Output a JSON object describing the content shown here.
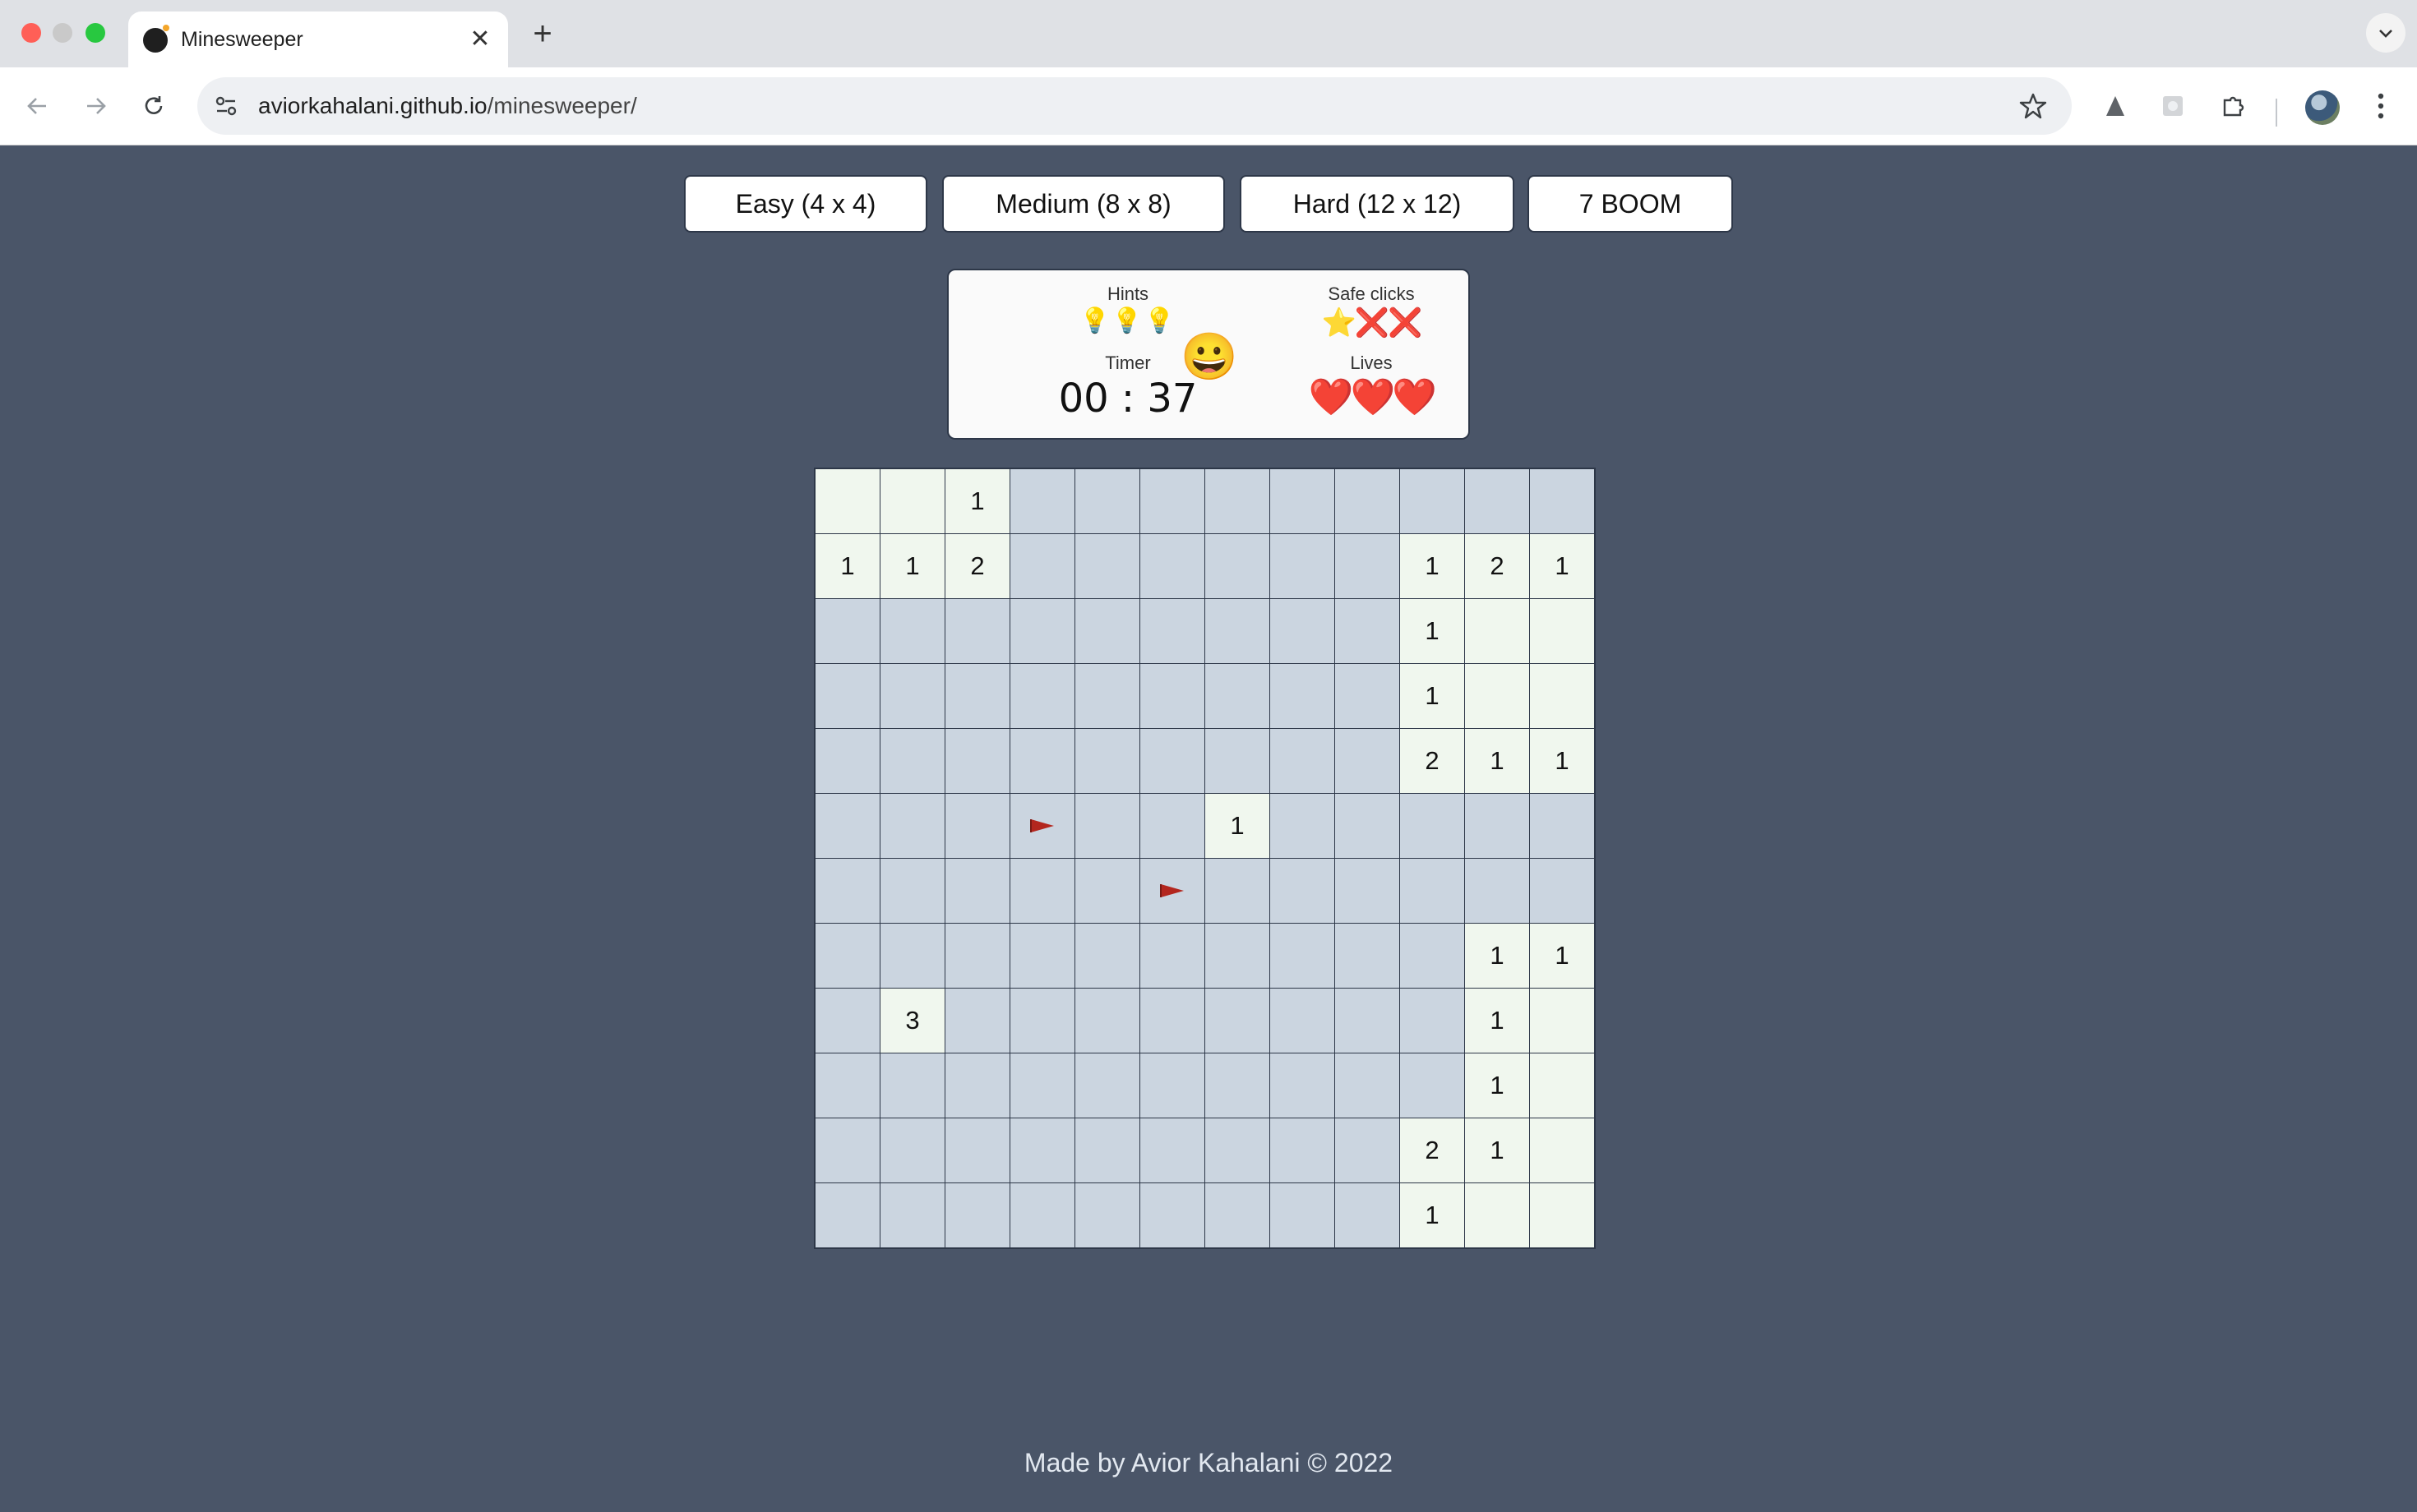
{
  "browser": {
    "tab_title": "Minesweeper",
    "tab_close": "✕",
    "new_tab": "+",
    "url_host": "aviorkahalani.github.io",
    "url_path": "/minesweeper/"
  },
  "levels": [
    {
      "label": "Easy (4 x 4)"
    },
    {
      "label": "Medium (8 x 8)"
    },
    {
      "label": "Hard (12 x 12)"
    },
    {
      "label": "7 BOOM"
    }
  ],
  "stats": {
    "hints_label": "Hints",
    "hints_value": "💡💡💡",
    "timer_label": "Timer",
    "timer_value": "00 : 37",
    "smiley": "😀",
    "safe_clicks_label": "Safe clicks",
    "safe_clicks_value": "⭐❌❌",
    "lives_label": "Lives",
    "lives_value": "❤️❤️❤️"
  },
  "board": {
    "rows": [
      [
        "R",
        "R",
        "1",
        "",
        "",
        "",
        "",
        "",
        "",
        "",
        "",
        ""
      ],
      [
        "1",
        "1",
        "2",
        "",
        "",
        "",
        "",
        "",
        "",
        "1",
        "2",
        "1"
      ],
      [
        "",
        "",
        "",
        "",
        "",
        "",
        "",
        "",
        "",
        "1",
        "R",
        "R"
      ],
      [
        "",
        "",
        "",
        "",
        "",
        "",
        "",
        "",
        "",
        "1",
        "R",
        "R"
      ],
      [
        "",
        "",
        "",
        "",
        "",
        "",
        "",
        "",
        "",
        "2",
        "1",
        "1"
      ],
      [
        "",
        "",
        "",
        "F",
        "",
        "",
        "1",
        "",
        "",
        "",
        "",
        ""
      ],
      [
        "",
        "",
        "",
        "",
        "",
        "F",
        "",
        "",
        "",
        "",
        "",
        ""
      ],
      [
        "",
        "",
        "",
        "",
        "",
        "",
        "",
        "",
        "",
        "",
        "1",
        "1"
      ],
      [
        "",
        "3",
        "",
        "",
        "",
        "",
        "",
        "",
        "",
        "",
        "1",
        "R"
      ],
      [
        "",
        "",
        "",
        "",
        "",
        "",
        "",
        "",
        "",
        "",
        "1",
        "R"
      ],
      [
        "",
        "",
        "",
        "",
        "",
        "",
        "",
        "",
        "",
        "2",
        "1",
        "R"
      ],
      [
        "",
        "",
        "",
        "",
        "",
        "",
        "",
        "",
        "",
        "1",
        "R",
        "R"
      ]
    ],
    "legend": {
      "R": "revealed-empty",
      "F": "flag",
      "": "hidden"
    }
  },
  "footer": "Made by Avior Kahalani © 2022"
}
